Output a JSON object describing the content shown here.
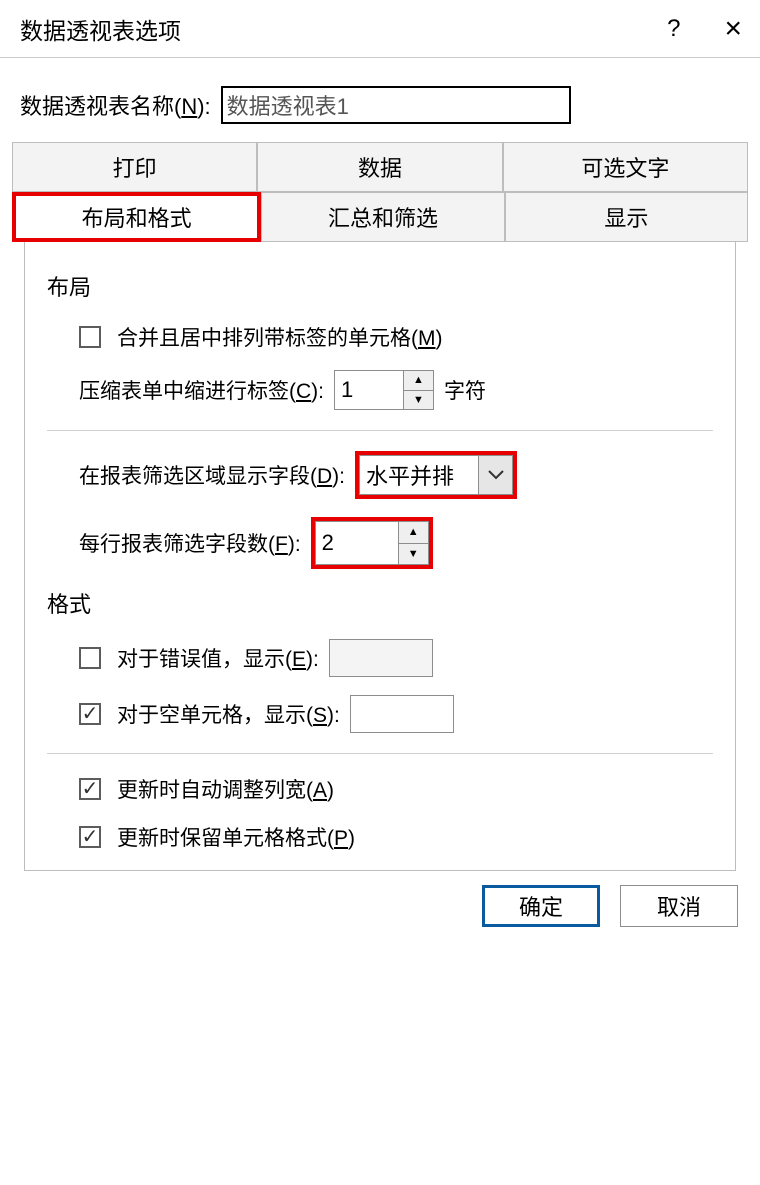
{
  "titlebar": {
    "title": "数据透视表选项"
  },
  "name_row": {
    "label_pre": "数据透视表名称(",
    "label_u": "N",
    "label_post": "):",
    "value": "数据透视表1"
  },
  "tabs": {
    "row1": [
      "打印",
      "数据",
      "可选文字"
    ],
    "row2": [
      "布局和格式",
      "汇总和筛选",
      "显示"
    ]
  },
  "layout": {
    "group_title": "布局",
    "merge_label_pre": "合并且居中排列带标签的单元格(",
    "merge_label_u": "M",
    "merge_label_post": ")",
    "compact_label_pre": "压缩表单中缩进行标签(",
    "compact_label_u": "C",
    "compact_label_post": "):",
    "compact_value": "1",
    "compact_unit": "字符",
    "filter_label_pre": "在报表筛选区域显示字段(",
    "filter_label_u": "D",
    "filter_label_post": "):",
    "filter_combo": "水平并排",
    "fields_label_pre": "每行报表筛选字段数(",
    "fields_label_u": "F",
    "fields_label_post": "):",
    "fields_value": "2"
  },
  "format": {
    "group_title": "格式",
    "err_label_pre": "对于错误值，显示(",
    "err_label_u": "E",
    "err_label_post": "):",
    "empty_label_pre": "对于空单元格，显示(",
    "empty_label_u": "S",
    "empty_label_post": "):",
    "autofit_label_pre": "更新时自动调整列宽(",
    "autofit_label_u": "A",
    "autofit_label_post": ")",
    "preserve_label_pre": "更新时保留单元格格式(",
    "preserve_label_u": "P",
    "preserve_label_post": ")"
  },
  "footer": {
    "ok": "确定",
    "cancel": "取消"
  }
}
